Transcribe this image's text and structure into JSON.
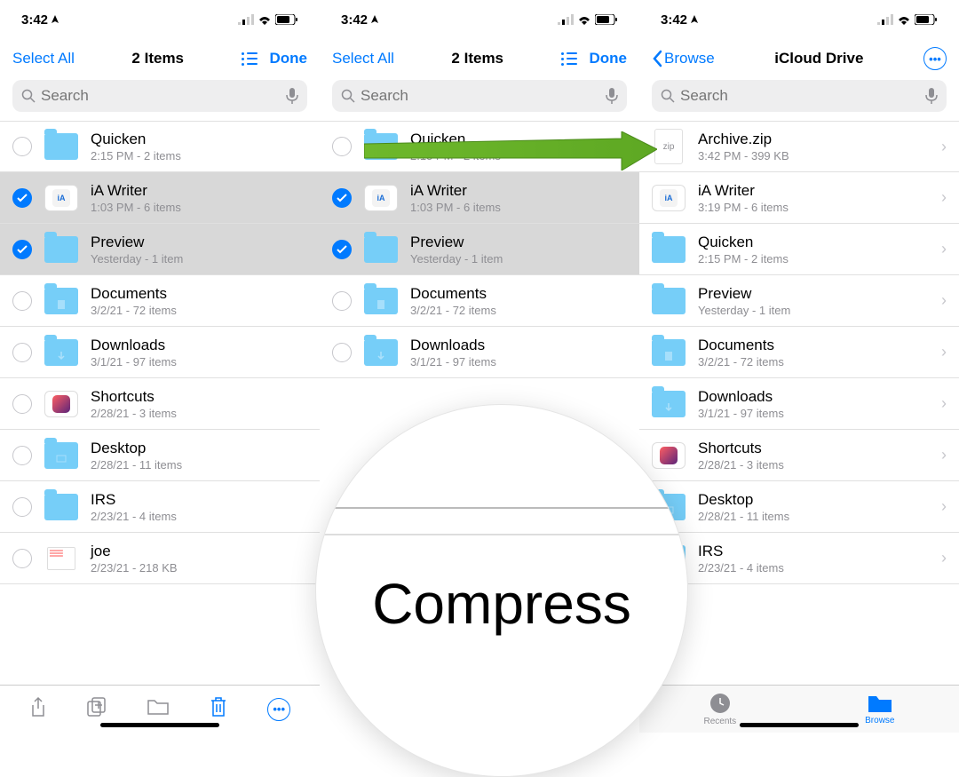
{
  "statusbar": {
    "time": "3:42"
  },
  "screen1": {
    "nav": {
      "left": "Select All",
      "title": "2 Items",
      "right": "Done"
    },
    "search_placeholder": "Search",
    "items": [
      {
        "name": "Quicken",
        "meta": "2:15 PM - 2 items",
        "selected": false,
        "type": "folder"
      },
      {
        "name": "iA Writer",
        "meta": "1:03 PM - 6 items",
        "selected": true,
        "type": "app-iA"
      },
      {
        "name": "Preview",
        "meta": "Yesterday - 1 item",
        "selected": true,
        "type": "folder"
      },
      {
        "name": "Documents",
        "meta": "3/2/21 - 72 items",
        "selected": false,
        "type": "folder-doc"
      },
      {
        "name": "Downloads",
        "meta": "3/1/21 - 97 items",
        "selected": false,
        "type": "folder-dl"
      },
      {
        "name": "Shortcuts",
        "meta": "2/28/21 - 3 items",
        "selected": false,
        "type": "app-shortcuts"
      },
      {
        "name": "Desktop",
        "meta": "2/28/21 - 11 items",
        "selected": false,
        "type": "folder-desk"
      },
      {
        "name": "IRS",
        "meta": "2/23/21 - 4 items",
        "selected": false,
        "type": "folder"
      },
      {
        "name": "joe",
        "meta": "2/23/21 - 218 KB",
        "selected": false,
        "type": "file"
      }
    ]
  },
  "screen2": {
    "nav": {
      "left": "Select All",
      "title": "2 Items",
      "right": "Done"
    },
    "search_placeholder": "Search",
    "items": [
      {
        "name": "Quicken",
        "meta": "2:15 PM - 2 items",
        "selected": false,
        "type": "folder"
      },
      {
        "name": "iA Writer",
        "meta": "1:03 PM - 6 items",
        "selected": true,
        "type": "app-iA"
      },
      {
        "name": "Preview",
        "meta": "Yesterday - 1 item",
        "selected": true,
        "type": "folder"
      },
      {
        "name": "Documents",
        "meta": "3/2/21 - 72 items",
        "selected": false,
        "type": "folder-doc"
      },
      {
        "name": "Downloads",
        "meta": "3/1/21 - 97 items",
        "selected": false,
        "type": "folder-dl"
      }
    ],
    "overlay_label": "Compress"
  },
  "screen3": {
    "nav": {
      "back": "Browse",
      "title": "iCloud Drive"
    },
    "search_placeholder": "Search",
    "items": [
      {
        "name": "Archive.zip",
        "meta": "3:42 PM - 399 KB",
        "type": "zip"
      },
      {
        "name": "iA Writer",
        "meta": "3:19 PM - 6 items",
        "type": "app-iA"
      },
      {
        "name": "Quicken",
        "meta": "2:15 PM - 2 items",
        "type": "folder"
      },
      {
        "name": "Preview",
        "meta": "Yesterday - 1 item",
        "type": "folder"
      },
      {
        "name": "Documents",
        "meta": "3/2/21 - 72 items",
        "type": "folder-doc"
      },
      {
        "name": "Downloads",
        "meta": "3/1/21 - 97 items",
        "type": "folder-dl"
      },
      {
        "name": "Shortcuts",
        "meta": "2/28/21 - 3 items",
        "type": "app-shortcuts"
      },
      {
        "name": "Desktop",
        "meta": "2/28/21 - 11 items",
        "type": "folder-desk"
      },
      {
        "name": "IRS",
        "meta": "2/23/21 - 4 items",
        "type": "folder"
      }
    ],
    "tabs": {
      "recents": "Recents",
      "browse": "Browse"
    }
  }
}
